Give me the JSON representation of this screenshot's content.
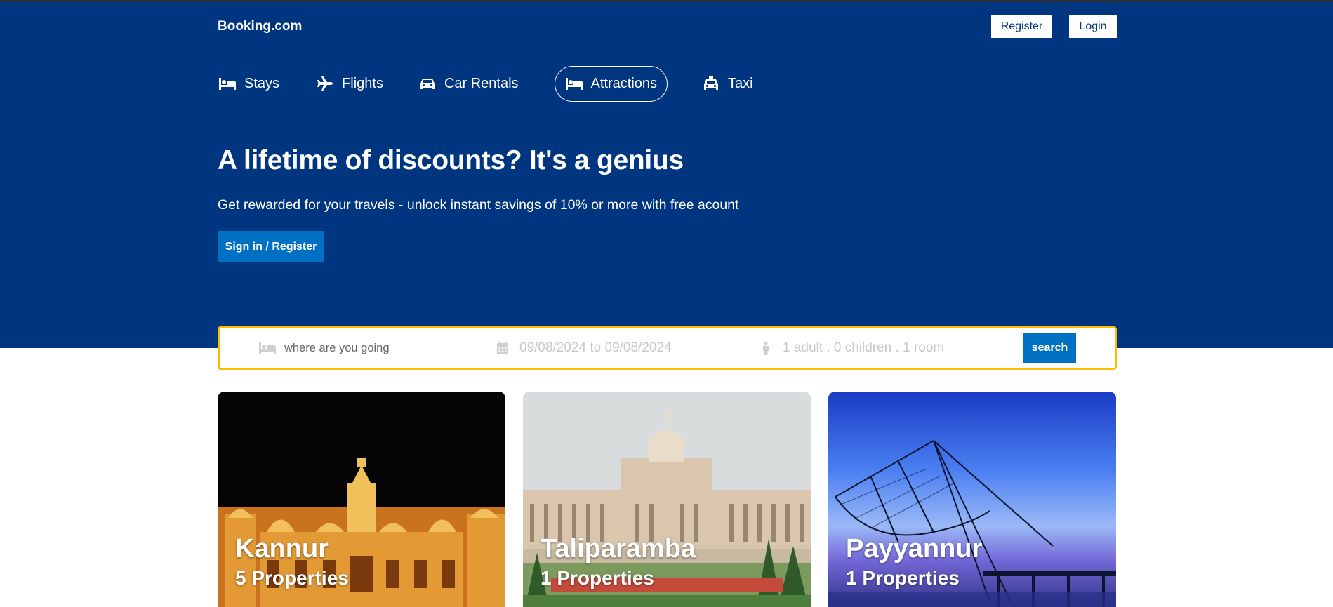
{
  "header": {
    "brand": "Booking.com",
    "register_label": "Register",
    "login_label": "Login"
  },
  "nav": {
    "items": [
      {
        "label": "Stays",
        "icon": "bed-icon"
      },
      {
        "label": "Flights",
        "icon": "plane-icon"
      },
      {
        "label": "Car Rentals",
        "icon": "car-icon"
      },
      {
        "label": "Attractions",
        "icon": "bed-icon",
        "active": true
      },
      {
        "label": "Taxi",
        "icon": "taxi-icon"
      }
    ]
  },
  "hero": {
    "headline": "A lifetime of discounts? It's a genius",
    "subline": "Get rewarded for your travels - unlock instant savings of 10% or more with free acount",
    "cta_label": "Sign in / Register"
  },
  "search": {
    "destination_placeholder": "where are you going",
    "dates": "09/08/2024 to 09/08/2024",
    "guests": "1 adult . 0 children . 1 room",
    "button_label": "search"
  },
  "cards": [
    {
      "city": "Kannur",
      "properties": "5 Properties"
    },
    {
      "city": "Taliparamba",
      "properties": "1 Properties"
    },
    {
      "city": "Payyannur",
      "properties": "1 Properties"
    }
  ],
  "colors": {
    "brand_blue": "#003580",
    "accent_blue": "#0071c2",
    "search_border": "#febb02"
  }
}
